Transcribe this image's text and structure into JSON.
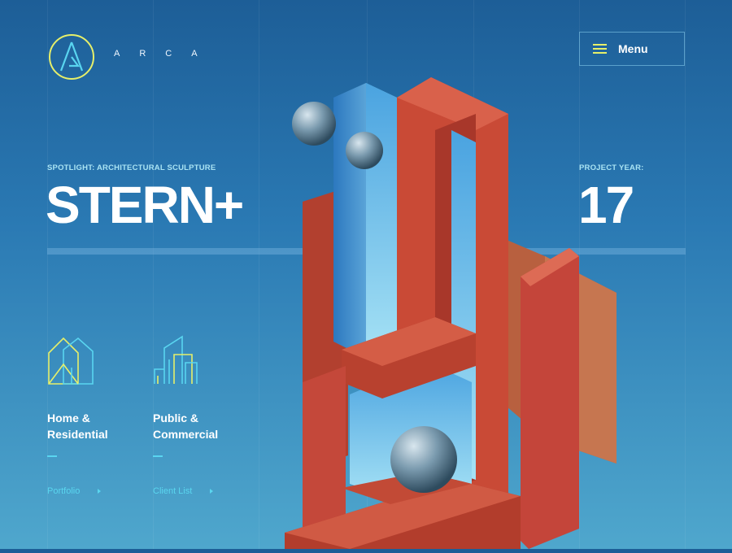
{
  "brand": {
    "letters": [
      "A",
      "R",
      "C",
      "A"
    ],
    "accent_color": "#e6ef6a",
    "logo_icon": "arca-logo-icon"
  },
  "menu": {
    "label": "Menu",
    "icon": "hamburger-icon"
  },
  "spotlight": {
    "eyebrow": "SPOTLIGHT: ARCHITECTURAL SCULPTURE",
    "title": "STERN+"
  },
  "project": {
    "eyebrow": "PROJECT YEAR:",
    "year": "17"
  },
  "categories": [
    {
      "label_line1": "Home &",
      "label_line2": "Residential",
      "link": "Portfolio",
      "icon": "house-icon"
    },
    {
      "label_line1": "Public &",
      "label_line2": "Commercial",
      "link": "Client List",
      "icon": "buildings-icon"
    }
  ],
  "colors": {
    "link": "#5ad6ef",
    "sculpture_red": "#c9503d",
    "background_top": "#1d5e97",
    "background_bottom": "#4fa7cd"
  }
}
